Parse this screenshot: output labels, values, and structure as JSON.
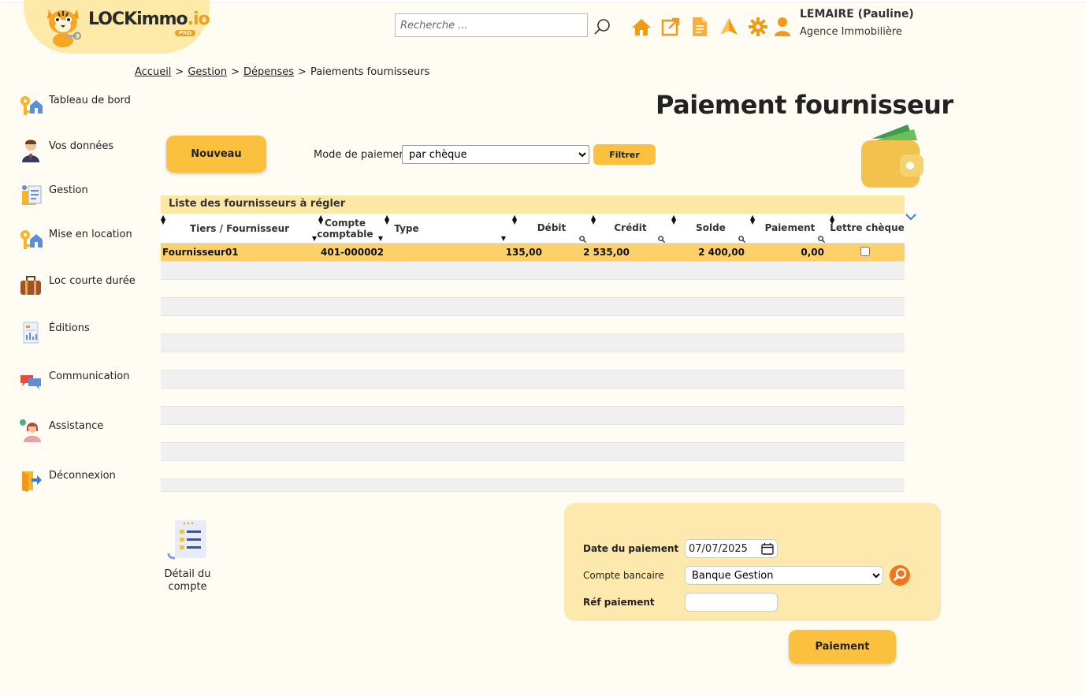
{
  "brand": {
    "name_main": "LOCKimmo",
    "name_suffix": ".io",
    "badge": "PRO"
  },
  "header": {
    "search_placeholder": "Recherche ...",
    "user_name": "LEMAIRE (Pauline)",
    "user_agency": "Agence Immobilière"
  },
  "breadcrumb": {
    "items": [
      "Accueil",
      "Gestion",
      "Dépenses"
    ],
    "current": "Paiements fournisseurs",
    "sep": ">"
  },
  "sidebar": {
    "items": [
      {
        "label": "Tableau de bord"
      },
      {
        "label": "Vos données"
      },
      {
        "label": "Gestion"
      },
      {
        "label": "Mise en location"
      },
      {
        "label": "Loc courte durée"
      },
      {
        "label": "Éditions"
      },
      {
        "label": "Communication"
      },
      {
        "label": "Assistance"
      },
      {
        "label": "Déconnexion"
      }
    ]
  },
  "page": {
    "title": "Paiement fournisseur"
  },
  "toolbar": {
    "new_label": "Nouveau",
    "payment_mode_label": "Mode de paiement",
    "payment_mode_value": "par chèque",
    "filter_label": "Filtrer"
  },
  "grid": {
    "title": "Liste des fournisseurs à régler",
    "columns": [
      "Tiers / Fournisseur",
      "Compte comptable",
      "Type",
      "Débit",
      "Crédit",
      "Solde",
      "Paiement",
      "Lettre chèque"
    ],
    "rows": [
      {
        "tiers": "Fournisseur01",
        "compte": "401-000002",
        "type": "",
        "debit": "135,00",
        "credit": "2 535,00",
        "solde": "2 400,00",
        "paiement": "0,00",
        "lettre_cheque": false
      }
    ]
  },
  "detail": {
    "label": "Détail du compte"
  },
  "form": {
    "date_label": "Date du paiement",
    "date_value": "07/07/2025",
    "bank_label": "Compte bancaire",
    "bank_value": "Banque Gestion",
    "ref_label": "Réf paiement",
    "ref_value": ""
  },
  "actions": {
    "pay_label": "Paiement"
  },
  "colors": {
    "accent": "#fbc03d",
    "icon_orange": "#f29a17",
    "panel": "#fde9ad",
    "selected_row": "#fdd06a"
  }
}
